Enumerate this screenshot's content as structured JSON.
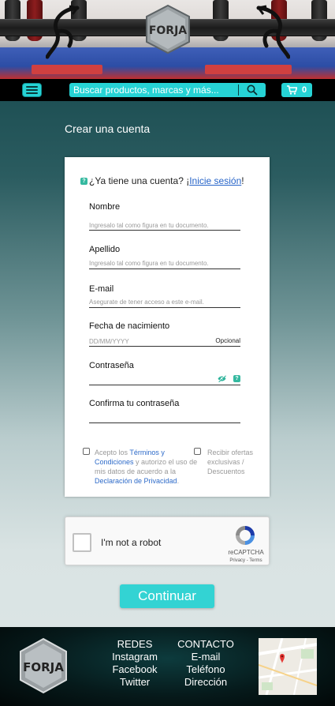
{
  "header": {
    "logo_text": "FORJA",
    "search": {
      "placeholder": "Buscar productos, marcas y más..."
    },
    "cart": {
      "count": "0"
    },
    "accent_color": "#26d3d5"
  },
  "page": {
    "title": "Crear una cuenta"
  },
  "form": {
    "login_prompt": "¿Ya tiene una cuenta? ¡",
    "login_link": "Inicie sesión",
    "login_suffix": "!",
    "fields": {
      "nombre": {
        "label": "Nombre",
        "placeholder": "Ingresalo tal como figura en tu documento."
      },
      "apellido": {
        "label": "Apellido",
        "placeholder": "Ingresalo tal como figura en tu documento."
      },
      "email": {
        "label": "E-mail",
        "placeholder": "Asegurate de tener acceso a este e-mail."
      },
      "fecha": {
        "label": "Fecha de nacimiento",
        "placeholder": "DD/MM/YYYY",
        "hint": "Opcional"
      },
      "password": {
        "label": "Contraseña"
      },
      "confirm": {
        "label": "Confirma tu contraseña"
      }
    },
    "terms": {
      "prefix": "Acepto los ",
      "terms_link": "Términos y Condiciones",
      "middle": " y autorizo el uso de mis datos de acuerdo a la ",
      "privacy_link": "Declaración de Privacidad",
      "suffix": "."
    },
    "offers_label": "Recibir ofertas exclusivas / Descuentos"
  },
  "captcha": {
    "label": "I'm not a robot",
    "brand": "reCAPTCHA",
    "privacy": "Privacy",
    "sep": " - ",
    "terms": "Terms"
  },
  "continue_label": "Continuar",
  "footer": {
    "logo_text": "FORJA",
    "redes": {
      "title": "REDES",
      "items": [
        "Instagram",
        "Facebook",
        "Twitter"
      ]
    },
    "contacto": {
      "title": "CONTACTO",
      "items": [
        "E-mail",
        "Teléfono",
        "Dirección"
      ]
    }
  }
}
